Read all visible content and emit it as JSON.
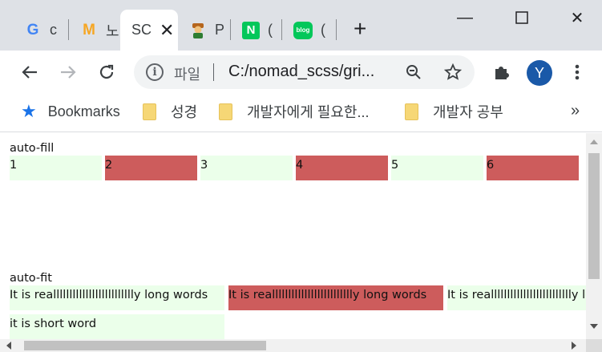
{
  "tabs": [
    {
      "favicon": "G",
      "label": "c",
      "color": "#4285f4"
    },
    {
      "favicon": "M",
      "label": "노",
      "color": "#f6a623"
    },
    {
      "favicon": "",
      "label": "SC",
      "active": true
    },
    {
      "favicon": "person-icon",
      "label": "P"
    },
    {
      "favicon": "N",
      "label": "(",
      "color": "#03c75a"
    },
    {
      "favicon": "blog",
      "label": "(",
      "color": "#03c75a"
    }
  ],
  "window": {
    "minimize": "—",
    "maximize": "☐",
    "close": "✕"
  },
  "toolbar": {
    "omnibox_scheme": "파일",
    "omnibox_url": "C:/nomad_scss/gri...",
    "avatar_letter": "Y"
  },
  "bookmarks": {
    "items": [
      {
        "label": "Bookmarks"
      },
      {
        "label": "성경"
      },
      {
        "label": "개발자에게 필요한..."
      },
      {
        "label": "개발자 공부"
      }
    ],
    "more": "»"
  },
  "page": {
    "auto_fill_title": "auto-fill",
    "auto_fill_items": [
      "1",
      "2",
      "3",
      "4",
      "5",
      "6"
    ],
    "auto_fit_title": "auto-fit",
    "auto_fit_items": [
      "It is reallllllllllllllllllllllllly long words",
      "It is reallllllllllllllllllllllllly long words",
      "It is reallllllllllllllllllllllllly long words"
    ],
    "short_item": "it is short word"
  },
  "colors": {
    "light_cell": "#ebffea",
    "red_cell": "#cd5c5c"
  }
}
